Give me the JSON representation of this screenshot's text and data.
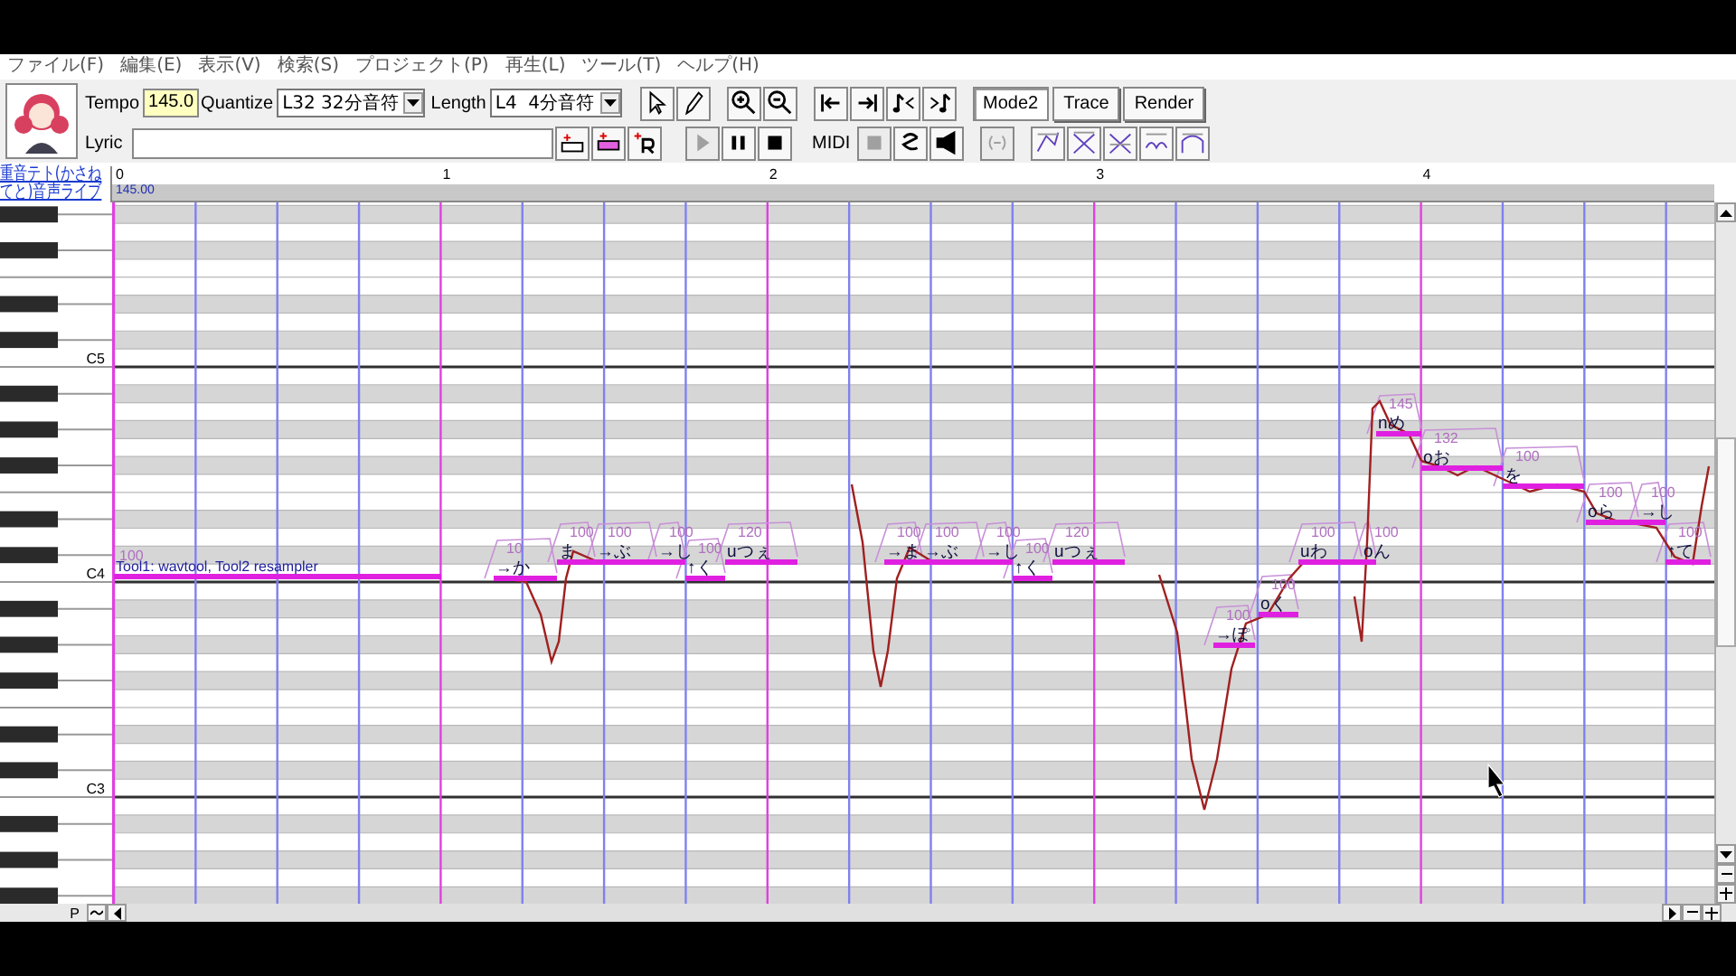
{
  "menu": [
    "ファイル(F)",
    "編集(E)",
    "表示(V)",
    "検索(S)",
    "プロジェクト(P)",
    "再生(L)",
    "ツール(T)",
    "ヘルプ(H)"
  ],
  "toolbar": {
    "tempo_label": "Tempo",
    "tempo": "145.0",
    "quantize_label": "Quantize",
    "quantize": "L32 32分音符",
    "length_label": "Length",
    "length": "L4  4分音符",
    "lyric_label": "Lyric",
    "midi_label": "MIDI",
    "modes": [
      {
        "label": "Mode2",
        "selected": true
      },
      {
        "label": "Trace",
        "selected": false
      },
      {
        "label": "Render",
        "selected": false
      }
    ],
    "transport": [
      {
        "kind": "play",
        "disabled": true
      },
      {
        "kind": "pause",
        "disabled": false
      },
      {
        "kind": "stop",
        "disabled": false
      }
    ],
    "midi_controls": [
      {
        "kind": "stop",
        "disabled": true
      },
      {
        "kind": "loop",
        "disabled": false
      },
      {
        "kind": "speaker",
        "disabled": false
      },
      {
        "kind": "link",
        "disabled": true
      }
    ]
  },
  "voicebank": [
    "重音テト(かさね",
    "てと)音声ライブ"
  ],
  "ruler": {
    "measures": [
      "0",
      "1",
      "2",
      "3",
      "4"
    ],
    "tempo": "145.00"
  },
  "keys": [
    "C5",
    "C4",
    "C3"
  ],
  "notes": [
    {
      "lyric": "Tool1: wavtool, Tool2 resampler",
      "intensity": "100"
    },
    {
      "lyric": "→か",
      "intensity": "10"
    },
    {
      "lyric": "ま",
      "intensity": "100"
    },
    {
      "lyric": "→ぶ",
      "intensity": "100"
    },
    {
      "lyric": "→し",
      "intensity": "100"
    },
    {
      "lyric": "↑く",
      "intensity": "100"
    },
    {
      "lyric": "uつぇ",
      "intensity": "120"
    },
    {
      "lyric": "→ま",
      "intensity": "100"
    },
    {
      "lyric": "→ぶ",
      "intensity": "100"
    },
    {
      "lyric": "→し",
      "intensity": "100"
    },
    {
      "lyric": "↑く",
      "intensity": "100"
    },
    {
      "lyric": "uつぇ",
      "intensity": "120"
    },
    {
      "lyric": "→ぽ",
      "intensity": "100"
    },
    {
      "lyric": "oく",
      "intensity": "100"
    },
    {
      "lyric": "uわ",
      "intensity": "100"
    },
    {
      "lyric": "oん",
      "intensity": "100"
    },
    {
      "lyric": "nめ",
      "intensity": "145"
    },
    {
      "lyric": "oお",
      "intensity": "132"
    },
    {
      "lyric": "を",
      "intensity": "100"
    },
    {
      "lyric": "oら",
      "intensity": "100"
    },
    {
      "lyric": "→し",
      "intensity": "100"
    },
    {
      "lyric": "↑て",
      "intensity": "100"
    }
  ],
  "hscroll": {
    "label": "P"
  }
}
